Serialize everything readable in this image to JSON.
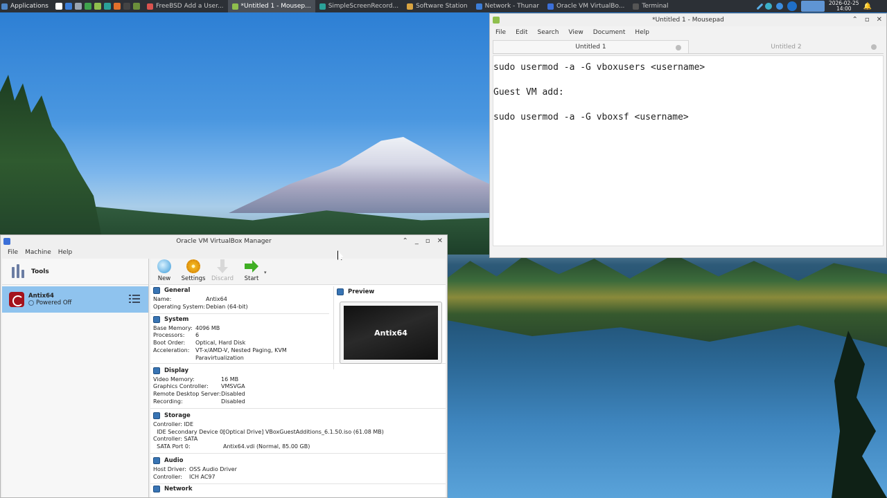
{
  "taskbar": {
    "applications_label": "Applications",
    "tasks": [
      {
        "label": "FreeBSD Add a User...",
        "active": false,
        "color": "#d9534f"
      },
      {
        "label": "*Untitled 1 - Mousep...",
        "active": true,
        "color": "#8fbf4d"
      },
      {
        "label": "SimpleScreenRecord...",
        "active": false,
        "color": "#2aa198"
      },
      {
        "label": "Software Station",
        "active": false,
        "color": "#d9a441"
      },
      {
        "label": "Network - Thunar",
        "active": false,
        "color": "#3b7dd8"
      },
      {
        "label": "Oracle VM VirtualBo...",
        "active": false,
        "color": "#3b6fd8"
      },
      {
        "label": "Terminal",
        "active": false,
        "color": "#555555"
      }
    ],
    "clock_date": "2026-02-25",
    "clock_time": "14:00"
  },
  "mousepad": {
    "title": "*Untitled 1 - Mousepad",
    "menu": [
      "File",
      "Edit",
      "Search",
      "View",
      "Document",
      "Help"
    ],
    "tabs": [
      "Untitled 1",
      "Untitled 2"
    ],
    "lines": [
      "sudo usermod -a -G vboxusers <username>",
      "",
      "Guest VM add:",
      "",
      "sudo usermod -a -G vboxsf <username>"
    ]
  },
  "vbox": {
    "title": "Oracle VM VirtualBox Manager",
    "menu": [
      "File",
      "Machine",
      "Help"
    ],
    "tools_label": "Tools",
    "vm": {
      "name": "Antix64",
      "state": "Powered Off"
    },
    "toolbar": {
      "new": "New",
      "settings": "Settings",
      "discard": "Discard",
      "start": "Start"
    },
    "general": {
      "title": "General",
      "rows": [
        [
          "Name:",
          "Antix64"
        ],
        [
          "Operating System:",
          "Debian (64-bit)"
        ]
      ]
    },
    "system": {
      "title": "System",
      "rows": [
        [
          "Base Memory:",
          "4096 MB"
        ],
        [
          "Processors:",
          "6"
        ],
        [
          "Boot Order:",
          "Optical, Hard Disk"
        ],
        [
          "Acceleration:",
          "VT-x/AMD-V, Nested Paging, KVM"
        ],
        [
          "",
          "Paravirtualization"
        ]
      ]
    },
    "preview": {
      "title": "Preview",
      "screen_text": "Antix64"
    },
    "display": {
      "title": "Display",
      "rows": [
        [
          "Video Memory:",
          "16 MB"
        ],
        [
          "Graphics Controller:",
          "VMSVGA"
        ],
        [
          "Remote Desktop Server:",
          "Disabled"
        ],
        [
          "Recording:",
          "Disabled"
        ]
      ]
    },
    "storage": {
      "title": "Storage",
      "rows": [
        [
          "Controller: IDE",
          ""
        ],
        [
          "  IDE Secondary Device 0:",
          "[Optical Drive] VBoxGuestAdditions_6.1.50.iso (61.08 MB)"
        ],
        [
          "Controller: SATA",
          ""
        ],
        [
          "  SATA Port 0:",
          "Antix64.vdi (Normal, 85.00 GB)"
        ]
      ]
    },
    "audio": {
      "title": "Audio",
      "rows": [
        [
          "Host Driver:",
          "OSS Audio Driver"
        ],
        [
          "Controller:",
          "ICH AC97"
        ]
      ]
    },
    "network_title": "Network"
  }
}
